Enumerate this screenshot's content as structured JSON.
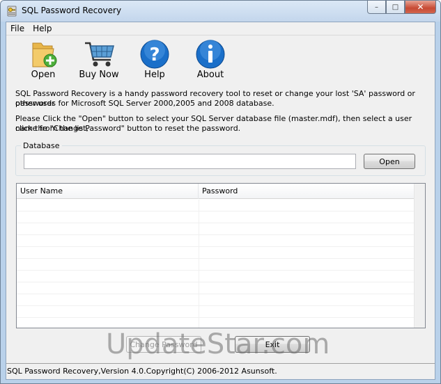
{
  "window": {
    "title": "SQL Password Recovery",
    "minimize": "–",
    "maximize": "□",
    "close": "✕"
  },
  "menu": [
    "File",
    "Help"
  ],
  "toolbar": {
    "open": "Open",
    "buy_now": "Buy Now",
    "help": "Help",
    "about": "About"
  },
  "description": {
    "line1": "SQL Password Recovery is a handy password recovery tool to reset or change your lost 'SA' password or other user",
    "line2": "passwords for Microsoft SQL Server 2000,2005 and 2008 database.",
    "line3": "Please Click the \"Open\" button to select your SQL Server database file (master.mdf), then select a user name from the list,",
    "line4": "click the \"Change Password\" button to reset the password."
  },
  "database": {
    "label": "Database",
    "value": "",
    "open_button": "Open"
  },
  "table": {
    "columns": [
      "User Name",
      "Password"
    ],
    "rows": []
  },
  "buttons": {
    "change_password": "Change Password",
    "exit": "Exit"
  },
  "status": "SQL Password Recovery,Version 4.0.Copyright(C) 2006-2012 Asunsoft.",
  "watermark": "UpdateStar.com",
  "colors": {
    "titlebar": "#c3d6ec",
    "close_button": "#c74a33",
    "client_bg": "#f0f0f0",
    "help_icon_blue": "#1a6fc9",
    "folder_yellow": "#e8b64a",
    "plus_green": "#4cae3a"
  }
}
